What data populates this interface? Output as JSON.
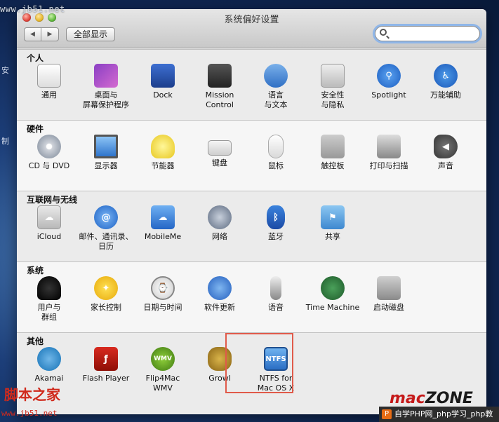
{
  "watermark_top": "www.jb51.net",
  "side_texts": [
    "安",
    "制"
  ],
  "window": {
    "title": "系统偏好设置",
    "show_all": "全部显示",
    "search_placeholder": ""
  },
  "sections": [
    {
      "title": "个人",
      "items": [
        {
          "label": "通用",
          "icon": "general-icon"
        },
        {
          "label": "桌面与\n屏幕保护程序",
          "icon": "desktop-screensaver-icon"
        },
        {
          "label": "Dock",
          "icon": "dock-icon"
        },
        {
          "label": "Mission\nControl",
          "icon": "mission-control-icon"
        },
        {
          "label": "语言\n与文本",
          "icon": "language-text-icon"
        },
        {
          "label": "安全性\n与隐私",
          "icon": "security-privacy-icon"
        },
        {
          "label": "Spotlight",
          "icon": "spotlight-icon"
        },
        {
          "label": "万能辅助",
          "icon": "universal-access-icon"
        }
      ]
    },
    {
      "title": "硬件",
      "items": [
        {
          "label": "CD 与 DVD",
          "icon": "cd-dvd-icon"
        },
        {
          "label": "显示器",
          "icon": "displays-icon"
        },
        {
          "label": "节能器",
          "icon": "energy-saver-icon"
        },
        {
          "label": "键盘",
          "icon": "keyboard-icon"
        },
        {
          "label": "鼠标",
          "icon": "mouse-icon"
        },
        {
          "label": "触控板",
          "icon": "trackpad-icon"
        },
        {
          "label": "打印与扫描",
          "icon": "print-scan-icon"
        },
        {
          "label": "声音",
          "icon": "sound-icon"
        }
      ]
    },
    {
      "title": "互联网与无线",
      "items": [
        {
          "label": "iCloud",
          "icon": "icloud-icon"
        },
        {
          "label": "邮件、通讯录、\n日历",
          "icon": "mail-contacts-calendar-icon"
        },
        {
          "label": "MobileMe",
          "icon": "mobileme-icon"
        },
        {
          "label": "网络",
          "icon": "network-icon"
        },
        {
          "label": "蓝牙",
          "icon": "bluetooth-icon"
        },
        {
          "label": "共享",
          "icon": "sharing-icon"
        }
      ]
    },
    {
      "title": "系统",
      "items": [
        {
          "label": "用户与\n群组",
          "icon": "users-groups-icon"
        },
        {
          "label": "家长控制",
          "icon": "parental-controls-icon"
        },
        {
          "label": "日期与时间",
          "icon": "date-time-icon"
        },
        {
          "label": "软件更新",
          "icon": "software-update-icon"
        },
        {
          "label": "语音",
          "icon": "speech-icon"
        },
        {
          "label": "Time Machine",
          "icon": "time-machine-icon"
        },
        {
          "label": "启动磁盘",
          "icon": "startup-disk-icon"
        }
      ]
    },
    {
      "title": "其他",
      "items": [
        {
          "label": "Akamai",
          "icon": "akamai-icon"
        },
        {
          "label": "Flash Player",
          "icon": "flash-player-icon"
        },
        {
          "label": "Flip4Mac\nWMV",
          "icon": "flip4mac-icon"
        },
        {
          "label": "Growl",
          "icon": "growl-icon"
        },
        {
          "label": "NTFS for\nMac OS X",
          "icon": "ntfs-icon",
          "icon_text": "NTFS"
        }
      ]
    }
  ],
  "brand_watermark": {
    "mac": "mac",
    "zone": "ZONE"
  },
  "watermark_bottom_left": "脚本之家",
  "watermark_bottom_url": "www.jb51.net",
  "php_badge": "自学PHP网_php学习_php教"
}
